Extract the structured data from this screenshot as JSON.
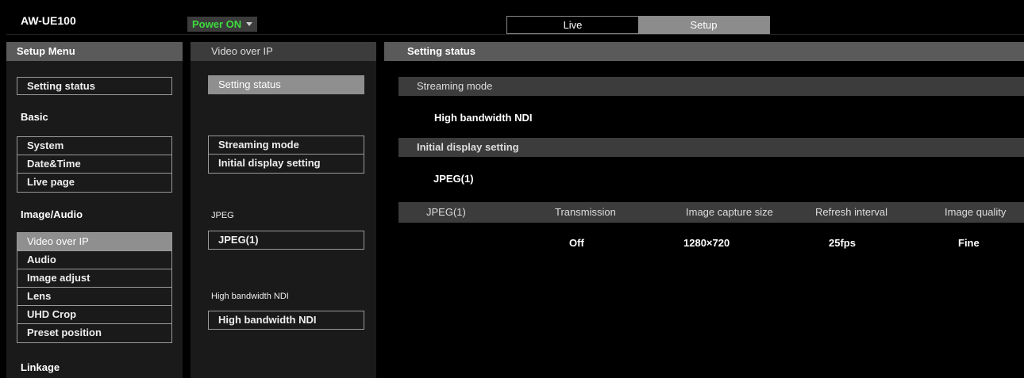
{
  "header": {
    "model": "AW-UE100",
    "power_label": "Power ON",
    "tabs": [
      {
        "label": "Live"
      },
      {
        "label": "Setup"
      }
    ]
  },
  "setup_menu": {
    "title": "Setup Menu",
    "setting_status": "Setting status",
    "basic": {
      "title": "Basic",
      "items": [
        "System",
        "Date&Time",
        "Live page"
      ]
    },
    "image_audio": {
      "title": "Image/Audio",
      "items": [
        "Video over IP",
        "Audio",
        "Image adjust",
        "Lens",
        "UHD Crop",
        "Preset position"
      ]
    },
    "linkage_title": "Linkage"
  },
  "sub_menu": {
    "title": "Video over IP",
    "setting_status": "Setting status",
    "items": [
      "Streaming mode",
      "Initial display setting"
    ],
    "jpeg_label": "JPEG",
    "jpeg_item": "JPEG(1)",
    "ndi_label": "High bandwidth NDI",
    "ndi_item": "High bandwidth NDI"
  },
  "content": {
    "title": "Setting status",
    "streaming_mode": {
      "heading": "Streaming mode",
      "value": "High bandwidth NDI"
    },
    "initial_display": {
      "heading": "Initial display setting",
      "value": "JPEG(1)"
    },
    "jpeg_table": {
      "headers": [
        "JPEG(1)",
        "Transmission",
        "Image capture size",
        "Refresh interval",
        "Image quality"
      ],
      "row": [
        "Off",
        "1280×720",
        "25fps",
        "Fine"
      ]
    }
  }
}
